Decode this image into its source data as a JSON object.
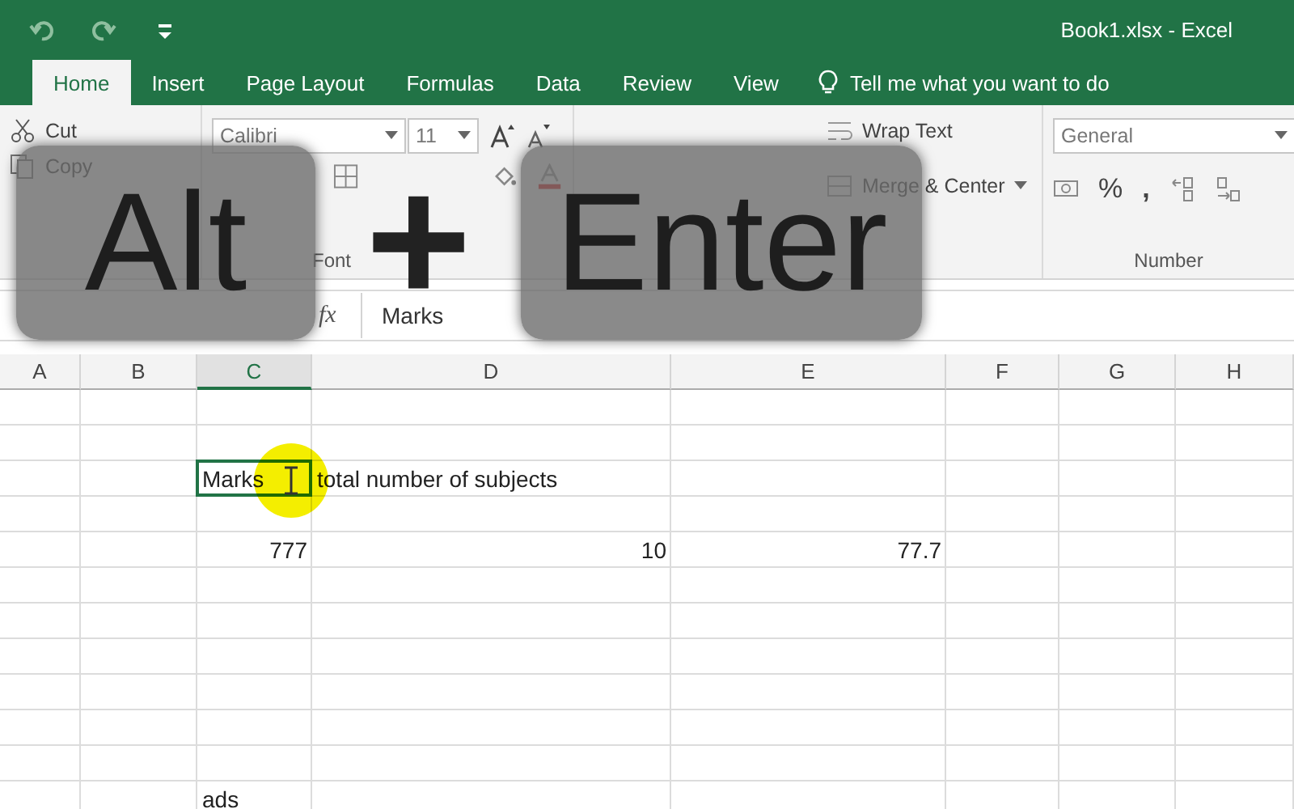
{
  "title_bar": {
    "title": "Book1.xlsx - Excel"
  },
  "tabs": [
    {
      "label": "Home",
      "selected": true
    },
    {
      "label": "Insert",
      "selected": false
    },
    {
      "label": "Page Layout",
      "selected": false
    },
    {
      "label": "Formulas",
      "selected": false
    },
    {
      "label": "Data",
      "selected": false
    },
    {
      "label": "Review",
      "selected": false
    },
    {
      "label": "View",
      "selected": false
    }
  ],
  "tell_me": "Tell me what you want to do",
  "ribbon": {
    "clipboard": {
      "cut": "Cut",
      "copy": "Copy"
    },
    "font": {
      "name": "Calibri",
      "size": "11",
      "group_label": "Font"
    },
    "alignment": {
      "wrap": "Wrap Text",
      "merge": "Merge & Center"
    },
    "number": {
      "format": "General",
      "percent": "%",
      "comma": ",",
      "group_label": "Number"
    }
  },
  "formula_bar": {
    "fx": "fx",
    "value": "Marks"
  },
  "columns": [
    {
      "label": "A",
      "selected": false
    },
    {
      "label": "B",
      "selected": false
    },
    {
      "label": "C",
      "selected": true
    },
    {
      "label": "D",
      "selected": false
    },
    {
      "label": "E",
      "selected": false
    },
    {
      "label": "F",
      "selected": false
    },
    {
      "label": "G",
      "selected": false
    },
    {
      "label": "H",
      "selected": false
    }
  ],
  "rows": [
    {},
    {},
    {
      "C": {
        "kind": "text",
        "text": "Marks",
        "continuation": "total number of subjects",
        "selected": true
      }
    },
    {},
    {
      "C": {
        "kind": "number",
        "text": "777",
        "selected": false
      },
      "D": {
        "kind": "number",
        "text": "10",
        "selected": false
      },
      "E": {
        "kind": "number",
        "text": "77.7",
        "selected": false
      }
    },
    {},
    {},
    {},
    {},
    {},
    {},
    {
      "C": {
        "kind": "text",
        "text": "ads",
        "selected": false
      }
    }
  ],
  "overlay_keys": [
    {
      "kind": "key",
      "label": "Alt"
    },
    {
      "kind": "plus",
      "label": "+"
    },
    {
      "kind": "key",
      "label": "Enter"
    }
  ]
}
